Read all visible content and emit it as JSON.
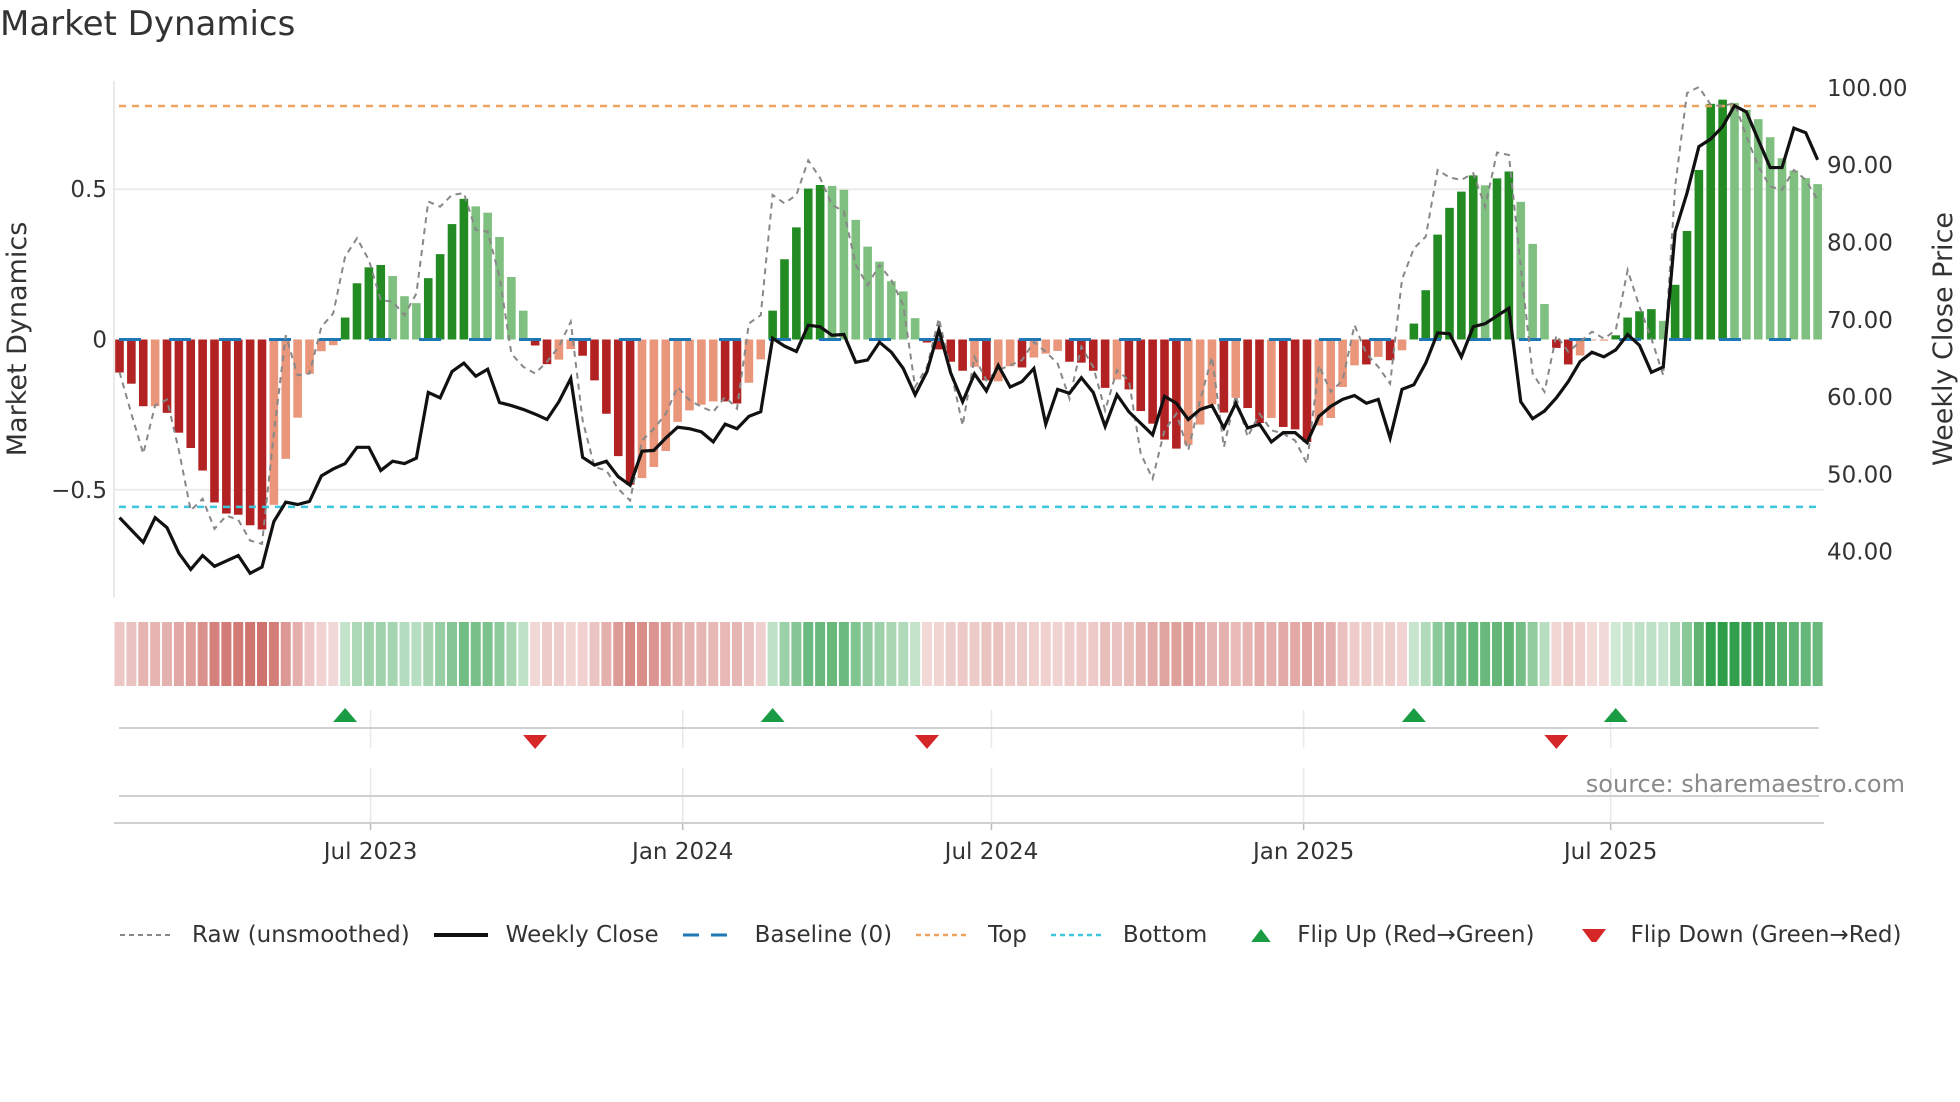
{
  "title": "Market Dynamics",
  "source": "source: sharemaestro.com",
  "chart_data": {
    "type": "bar",
    "title": "Market Dynamics",
    "first_week": "2023-02-03",
    "ylabel_left": "Market Dynamics",
    "ylabel_right": "Weekly Close Price",
    "ylim_left": [
      -0.86,
      0.86
    ],
    "ylim_right": [
      34.0,
      100.9
    ],
    "left_ticks": [
      {
        "v": 0.5,
        "label": "0.5"
      },
      {
        "v": 0,
        "label": "0"
      },
      {
        "v": -0.5,
        "label": "−0.5"
      }
    ],
    "right_ticks": [
      {
        "v": 100,
        "label": "100.00"
      },
      {
        "v": 90,
        "label": "90.00"
      },
      {
        "v": 80,
        "label": "80.00"
      },
      {
        "v": 70,
        "label": "70.00"
      },
      {
        "v": 60,
        "label": "60.00"
      },
      {
        "v": 50,
        "label": "50.00"
      },
      {
        "v": 40,
        "label": "40.00"
      }
    ],
    "x_ticks": [
      {
        "date": "2023-07-01",
        "label": "Jul 2023"
      },
      {
        "date": "2024-01-01",
        "label": "Jan 2024"
      },
      {
        "date": "2024-07-01",
        "label": "Jul 2024"
      },
      {
        "date": "2025-01-01",
        "label": "Jan 2025"
      },
      {
        "date": "2025-07-01",
        "label": "Jul 2025"
      }
    ],
    "top_level": 0.777,
    "bottom_level": -0.557,
    "baseline": 0,
    "momentum": [
      -0.11,
      -0.147,
      -0.222,
      -0.222,
      -0.244,
      -0.31,
      -0.361,
      -0.436,
      -0.542,
      -0.579,
      -0.583,
      -0.618,
      -0.632,
      -0.55,
      -0.397,
      -0.26,
      -0.114,
      -0.039,
      -0.019,
      0.073,
      0.187,
      0.24,
      0.248,
      0.211,
      0.144,
      0.121,
      0.204,
      0.284,
      0.384,
      0.468,
      0.443,
      0.422,
      0.341,
      0.208,
      0.096,
      -0.02,
      -0.082,
      -0.067,
      -0.032,
      -0.054,
      -0.136,
      -0.247,
      -0.388,
      -0.483,
      -0.461,
      -0.424,
      -0.371,
      -0.274,
      -0.236,
      -0.217,
      -0.206,
      -0.206,
      -0.213,
      -0.144,
      -0.066,
      0.096,
      0.267,
      0.373,
      0.502,
      0.514,
      0.511,
      0.498,
      0.398,
      0.309,
      0.259,
      0.194,
      0.16,
      0.071,
      -0.01,
      -0.033,
      -0.074,
      -0.104,
      -0.091,
      -0.136,
      -0.139,
      -0.089,
      -0.093,
      -0.06,
      -0.047,
      -0.038,
      -0.074,
      -0.077,
      -0.104,
      -0.161,
      -0.133,
      -0.166,
      -0.238,
      -0.28,
      -0.333,
      -0.363,
      -0.35,
      -0.283,
      -0.216,
      -0.243,
      -0.194,
      -0.228,
      -0.278,
      -0.261,
      -0.291,
      -0.299,
      -0.341,
      -0.286,
      -0.261,
      -0.158,
      -0.086,
      -0.083,
      -0.058,
      -0.069,
      -0.036,
      0.053,
      0.164,
      0.349,
      0.438,
      0.492,
      0.546,
      0.513,
      0.536,
      0.559,
      0.458,
      0.318,
      0.118,
      -0.028,
      -0.083,
      -0.053,
      -0.003,
      -0.004,
      0.014,
      0.073,
      0.094,
      0.101,
      0.062,
      0.182,
      0.361,
      0.564,
      0.784,
      0.798,
      0.787,
      0.764,
      0.733,
      0.673,
      0.603,
      0.562,
      0.537,
      0.517
    ],
    "strengthening": [
      1,
      1,
      1,
      0,
      1,
      1,
      1,
      1,
      1,
      1,
      1,
      1,
      1,
      0,
      0,
      0,
      0,
      0,
      0,
      1,
      1,
      1,
      1,
      0,
      0,
      0,
      1,
      1,
      1,
      1,
      0,
      0,
      0,
      0,
      0,
      1,
      1,
      0,
      0,
      1,
      1,
      1,
      1,
      1,
      0,
      0,
      0,
      0,
      0,
      0,
      0,
      1,
      1,
      0,
      0,
      1,
      1,
      1,
      1,
      1,
      0,
      0,
      0,
      0,
      0,
      0,
      0,
      0,
      1,
      1,
      1,
      1,
      0,
      1,
      0,
      0,
      1,
      0,
      0,
      0,
      1,
      1,
      1,
      1,
      0,
      1,
      1,
      1,
      1,
      1,
      0,
      0,
      0,
      1,
      0,
      1,
      1,
      0,
      1,
      1,
      1,
      0,
      0,
      0,
      0,
      1,
      0,
      1,
      0,
      1,
      1,
      1,
      1,
      1,
      1,
      0,
      1,
      1,
      0,
      0,
      0,
      1,
      1,
      0,
      0,
      0,
      1,
      1,
      1,
      1,
      0,
      1,
      1,
      1,
      1,
      1,
      0,
      0,
      0,
      0,
      0,
      0,
      0,
      0
    ],
    "raw": [
      -0.108,
      -0.247,
      -0.38,
      -0.219,
      -0.2,
      -0.369,
      -0.569,
      -0.53,
      -0.63,
      -0.586,
      -0.6,
      -0.669,
      -0.68,
      -0.313,
      0.014,
      -0.119,
      -0.113,
      0.042,
      0.087,
      0.276,
      0.337,
      0.264,
      0.131,
      0.126,
      0.081,
      0.153,
      0.459,
      0.442,
      0.481,
      0.487,
      0.364,
      0.359,
      0.209,
      -0.047,
      -0.091,
      -0.113,
      -0.074,
      -0.024,
      0.059,
      -0.269,
      -0.424,
      -0.436,
      -0.497,
      -0.536,
      -0.336,
      -0.297,
      -0.247,
      -0.158,
      -0.202,
      -0.224,
      -0.241,
      -0.191,
      -0.23,
      0.053,
      0.081,
      0.481,
      0.453,
      0.481,
      0.596,
      0.537,
      0.448,
      0.426,
      0.248,
      0.181,
      0.248,
      0.198,
      0.114,
      -0.158,
      -0.091,
      0.07,
      -0.102,
      -0.286,
      -0.058,
      -0.136,
      -0.102,
      -0.086,
      -0.069,
      -0.008,
      -0.041,
      -0.08,
      -0.197,
      -0.024,
      -0.091,
      -0.236,
      -0.102,
      -0.136,
      -0.38,
      -0.463,
      -0.302,
      -0.247,
      -0.369,
      -0.202,
      -0.058,
      -0.358,
      -0.186,
      -0.324,
      -0.247,
      -0.302,
      -0.313,
      -0.336,
      -0.413,
      -0.086,
      -0.174,
      -0.136,
      0.048,
      -0.047,
      -0.091,
      -0.147,
      0.2,
      0.303,
      0.342,
      0.564,
      0.539,
      0.531,
      0.553,
      0.442,
      0.622,
      0.614,
      0.242,
      -0.113,
      -0.174,
      0.014,
      -0.041,
      -0.008,
      0.026,
      0.003,
      0.031,
      0.231,
      0.109,
      0.003,
      -0.119,
      0.509,
      0.82,
      0.84,
      0.781,
      0.776,
      0.787,
      0.676,
      0.576,
      0.509,
      0.498,
      0.564,
      0.531,
      0.464
    ],
    "weekly_close": [
      44.4,
      42.8,
      41.2,
      44.4,
      43.1,
      39.8,
      37.7,
      39.5,
      38.1,
      38.8,
      39.5,
      37.2,
      38.0,
      43.9,
      46.4,
      46.1,
      46.5,
      49.8,
      50.7,
      51.4,
      53.5,
      53.5,
      50.5,
      51.7,
      51.4,
      52.1,
      60.6,
      59.9,
      63.3,
      64.4,
      62.7,
      63.6,
      59.3,
      58.9,
      58.4,
      57.8,
      57.1,
      59.4,
      62.4,
      52.2,
      51.2,
      51.7,
      49.7,
      48.6,
      53.0,
      53.1,
      54.7,
      56.1,
      55.9,
      55.5,
      54.2,
      56.5,
      55.9,
      57.5,
      58.1,
      67.6,
      66.6,
      65.9,
      69.3,
      69.1,
      68.0,
      68.1,
      64.5,
      64.8,
      67.1,
      65.8,
      63.7,
      60.3,
      63.3,
      68.7,
      63.1,
      59.4,
      63.0,
      60.8,
      64.1,
      61.3,
      62.0,
      63.7,
      56.5,
      61.0,
      60.5,
      62.5,
      60.6,
      56.2,
      60.3,
      58.1,
      56.6,
      55.1,
      60.1,
      59.2,
      57.1,
      58.4,
      58.9,
      56.0,
      59.2,
      56.0,
      56.5,
      54.2,
      55.4,
      55.4,
      54.1,
      57.5,
      58.8,
      59.7,
      60.2,
      59.2,
      59.7,
      54.7,
      61.0,
      61.6,
      64.4,
      68.3,
      68.2,
      65.2,
      69.1,
      69.5,
      70.5,
      71.5,
      59.4,
      57.2,
      58.2,
      59.9,
      62.0,
      64.6,
      65.8,
      65.2,
      66.1,
      68.1,
      66.7,
      63.2,
      63.9,
      81.4,
      86.4,
      92.4,
      93.4,
      95.0,
      97.7,
      96.9,
      93.3,
      89.7,
      89.7,
      94.8,
      94.2,
      90.7
    ],
    "flip_up_weeks": [
      20,
      56,
      110,
      127
    ],
    "flip_down_weeks": [
      36,
      69,
      122
    ],
    "legend": [
      "Raw (unsmoothed)",
      "Weekly Close",
      "Baseline (0)",
      "Top",
      "Bottom",
      "Flip Up (Red→Green)",
      "Flip Down (Green→Red)"
    ],
    "legend_position": "bottom",
    "colors": {
      "strong_up": "#228b22",
      "weak_up": "#7fbf7f",
      "strong_down": "#b22222",
      "weak_down": "#e9967a",
      "raw": "#888888",
      "close": "#111111",
      "baseline": "#1f77b4",
      "top": "#f0a35e",
      "bottom": "#3ec6dc",
      "flip_up": "#1a9c45",
      "flip_down": "#d62728",
      "strip_up": "#2f9e4a",
      "strip_down": "#c65650"
    }
  }
}
